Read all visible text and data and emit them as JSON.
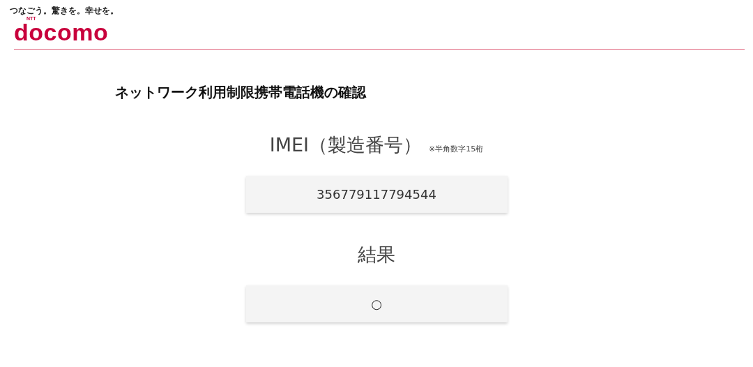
{
  "header": {
    "tagline": "つなごう。驚きを。幸せを。",
    "logo_superscript": "NTT",
    "logo": "docomo"
  },
  "title": "ネットワーク利用制限携帯電話機の確認",
  "imei": {
    "label": "IMEI（製造番号）",
    "note": "※半角数字15桁",
    "value": "356779117794544"
  },
  "result": {
    "label": "結果",
    "value": "○"
  }
}
